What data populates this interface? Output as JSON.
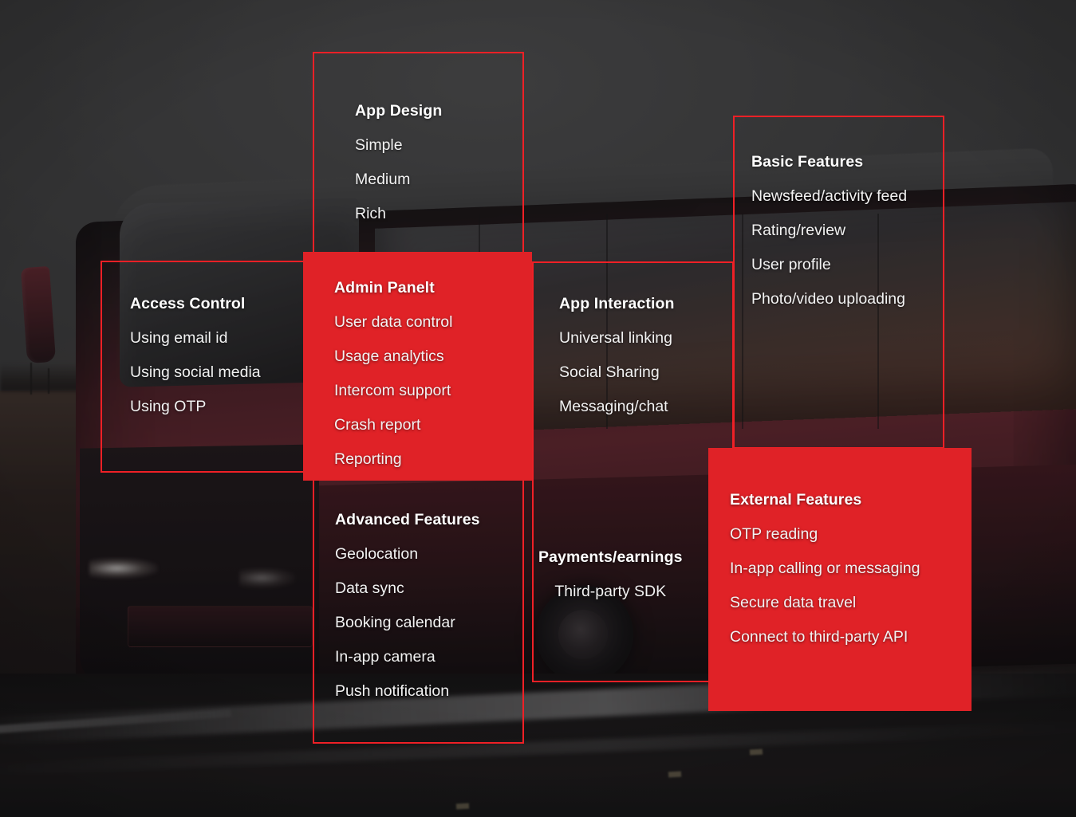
{
  "accent_colors": {
    "red_fill": "#e02227",
    "red_outline": "#ef2026",
    "text_primary": "#ffffff",
    "text_secondary": "#f2f2f2",
    "background_dark": "#2f2f2f"
  },
  "background": {
    "description": "dark-toned photograph of a red intercity coach bus on a road at dusk"
  },
  "boxes": [
    {
      "id": "app-design",
      "style": "outline",
      "title": "App Design",
      "items": [
        "Simple",
        "Medium",
        "Rich"
      ]
    },
    {
      "id": "access-control",
      "style": "outline",
      "title": "Access Control",
      "items": [
        "Using email id",
        "Using social media",
        "Using OTP"
      ]
    },
    {
      "id": "admin-panel",
      "style": "filled",
      "title": "Admin Panelt",
      "items": [
        "User data control",
        "Usage analytics",
        "Intercom support",
        "Crash report",
        "Reporting"
      ]
    },
    {
      "id": "app-interaction",
      "style": "outline",
      "title": "App Interaction",
      "items": [
        "Universal linking",
        "Social Sharing",
        "Messaging/chat"
      ]
    },
    {
      "id": "basic-features",
      "style": "outline",
      "title": "Basic Features",
      "items": [
        "Newsfeed/activity feed",
        "Rating/review",
        "User profile",
        "Photo/video uploading"
      ]
    },
    {
      "id": "advanced-features",
      "style": "outline",
      "title": "Advanced Features",
      "items": [
        "Geolocation",
        "Data sync",
        "Booking calendar",
        "In-app camera",
        "Push notification"
      ]
    },
    {
      "id": "payments",
      "style": "outline",
      "title": "Payments/earnings",
      "items": [
        "Third-party SDK"
      ]
    },
    {
      "id": "external-features",
      "style": "filled",
      "title": "External Features",
      "items": [
        "OTP reading",
        "In-app calling or messaging",
        "Secure data travel",
        "Connect to third-party API"
      ]
    }
  ]
}
